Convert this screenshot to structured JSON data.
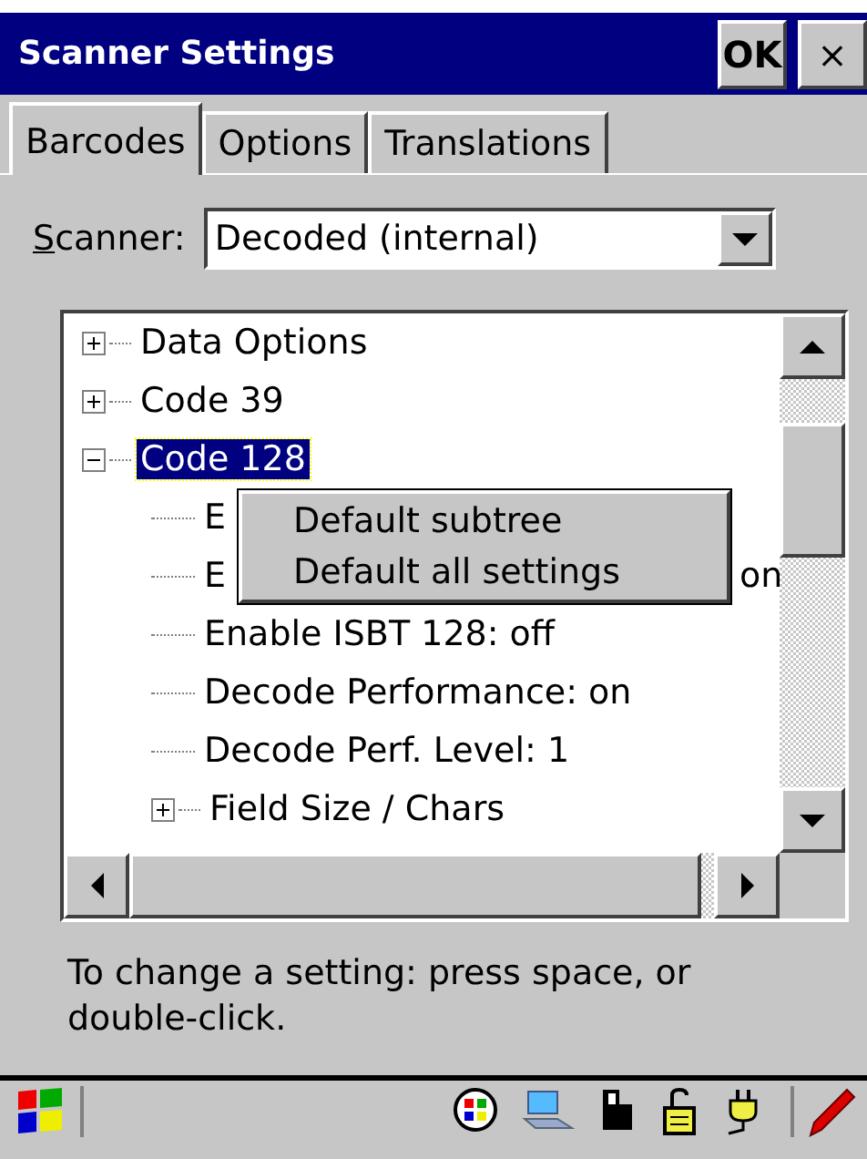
{
  "window": {
    "title": "Scanner Settings",
    "ok_button": "OK",
    "close_button": "×"
  },
  "tabs": [
    {
      "label": "Barcodes",
      "selected": true
    },
    {
      "label": "Options",
      "selected": false
    },
    {
      "label": "Translations",
      "selected": false
    }
  ],
  "scanner": {
    "label": "Scanner:",
    "value": "Decoded (internal)"
  },
  "tree": [
    {
      "label": "Data Options",
      "expanded": false,
      "selected": false
    },
    {
      "label": "Code 39",
      "expanded": false,
      "selected": false
    },
    {
      "label": "Code 128",
      "expanded": true,
      "selected": true,
      "children": [
        {
          "label": "E",
          "kind": "leaf"
        },
        {
          "label": "E",
          "tail": "on",
          "kind": "leaf"
        },
        {
          "label": "Enable ISBT 128: off",
          "kind": "leaf"
        },
        {
          "label": "Decode Performance: on",
          "kind": "leaf"
        },
        {
          "label": "Decode Perf. Level: 1",
          "kind": "leaf"
        },
        {
          "label": "Field Size / Chars",
          "kind": "branch"
        }
      ]
    }
  ],
  "context_menu": [
    "Default subtree",
    "Default all settings"
  ],
  "help_text": "To change a setting: press space, or double-click."
}
